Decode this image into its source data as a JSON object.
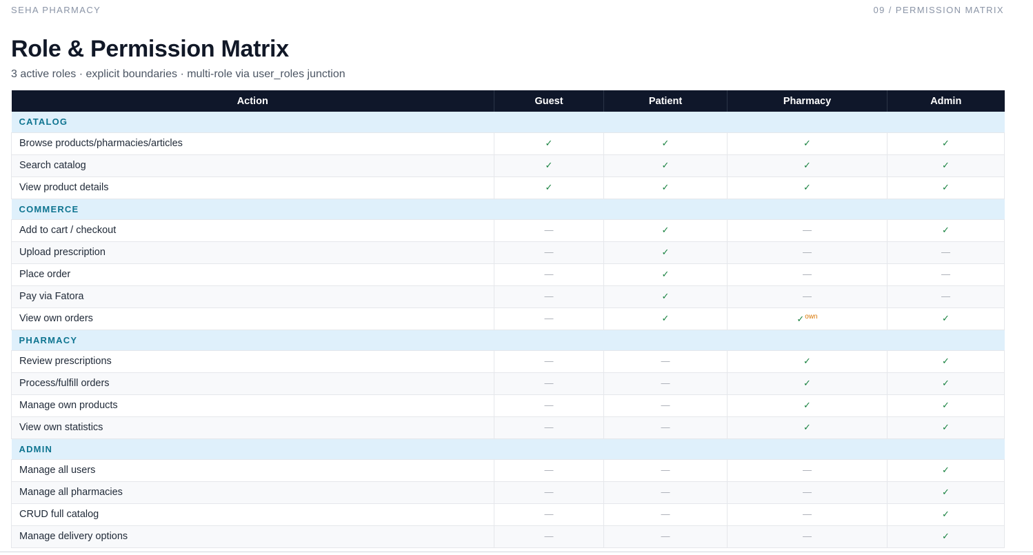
{
  "header": {
    "brand": "SEHA PHARMACY",
    "slide_label": "09 / PERMISSION MATRIX"
  },
  "page": {
    "title": "Role & Permission Matrix",
    "subtitle": "3 active roles · explicit boundaries · multi-role via user_roles junction"
  },
  "symbols": {
    "yes": "✓",
    "no": "—"
  },
  "colors": {
    "header_bg": "#0f172a",
    "section_bg": "#dff0fb",
    "section_text": "#0e7490",
    "check": "#15803d",
    "note": "#d97706"
  },
  "table": {
    "columns": [
      "Action",
      "Guest",
      "Patient",
      "Pharmacy",
      "Admin"
    ],
    "sections": [
      {
        "name": "CATALOG",
        "rows": [
          {
            "action": "Browse products/pharmacies/articles",
            "cells": [
              {
                "v": "yes"
              },
              {
                "v": "yes"
              },
              {
                "v": "yes"
              },
              {
                "v": "yes"
              }
            ]
          },
          {
            "action": "Search catalog",
            "cells": [
              {
                "v": "yes"
              },
              {
                "v": "yes"
              },
              {
                "v": "yes"
              },
              {
                "v": "yes"
              }
            ]
          },
          {
            "action": "View product details",
            "cells": [
              {
                "v": "yes"
              },
              {
                "v": "yes"
              },
              {
                "v": "yes"
              },
              {
                "v": "yes"
              }
            ]
          }
        ]
      },
      {
        "name": "COMMERCE",
        "rows": [
          {
            "action": "Add to cart / checkout",
            "cells": [
              {
                "v": "no"
              },
              {
                "v": "yes"
              },
              {
                "v": "no"
              },
              {
                "v": "yes"
              }
            ]
          },
          {
            "action": "Upload prescription",
            "cells": [
              {
                "v": "no"
              },
              {
                "v": "yes"
              },
              {
                "v": "no"
              },
              {
                "v": "no"
              }
            ]
          },
          {
            "action": "Place order",
            "cells": [
              {
                "v": "no"
              },
              {
                "v": "yes"
              },
              {
                "v": "no"
              },
              {
                "v": "no"
              }
            ]
          },
          {
            "action": "Pay via Fatora",
            "cells": [
              {
                "v": "no"
              },
              {
                "v": "yes"
              },
              {
                "v": "no"
              },
              {
                "v": "no"
              }
            ]
          },
          {
            "action": "View own orders",
            "cells": [
              {
                "v": "no"
              },
              {
                "v": "yes"
              },
              {
                "v": "yes",
                "note": "own"
              },
              {
                "v": "yes"
              }
            ]
          }
        ]
      },
      {
        "name": "PHARMACY",
        "rows": [
          {
            "action": "Review prescriptions",
            "cells": [
              {
                "v": "no"
              },
              {
                "v": "no"
              },
              {
                "v": "yes"
              },
              {
                "v": "yes"
              }
            ]
          },
          {
            "action": "Process/fulfill orders",
            "cells": [
              {
                "v": "no"
              },
              {
                "v": "no"
              },
              {
                "v": "yes"
              },
              {
                "v": "yes"
              }
            ]
          },
          {
            "action": "Manage own products",
            "cells": [
              {
                "v": "no"
              },
              {
                "v": "no"
              },
              {
                "v": "yes"
              },
              {
                "v": "yes"
              }
            ]
          },
          {
            "action": "View own statistics",
            "cells": [
              {
                "v": "no"
              },
              {
                "v": "no"
              },
              {
                "v": "yes"
              },
              {
                "v": "yes"
              }
            ]
          }
        ]
      },
      {
        "name": "ADMIN",
        "rows": [
          {
            "action": "Manage all users",
            "cells": [
              {
                "v": "no"
              },
              {
                "v": "no"
              },
              {
                "v": "no"
              },
              {
                "v": "yes"
              }
            ]
          },
          {
            "action": "Manage all pharmacies",
            "cells": [
              {
                "v": "no"
              },
              {
                "v": "no"
              },
              {
                "v": "no"
              },
              {
                "v": "yes"
              }
            ]
          },
          {
            "action": "CRUD full catalog",
            "cells": [
              {
                "v": "no"
              },
              {
                "v": "no"
              },
              {
                "v": "no"
              },
              {
                "v": "yes"
              }
            ]
          },
          {
            "action": "Manage delivery options",
            "cells": [
              {
                "v": "no"
              },
              {
                "v": "no"
              },
              {
                "v": "no"
              },
              {
                "v": "yes"
              }
            ]
          }
        ]
      }
    ]
  }
}
